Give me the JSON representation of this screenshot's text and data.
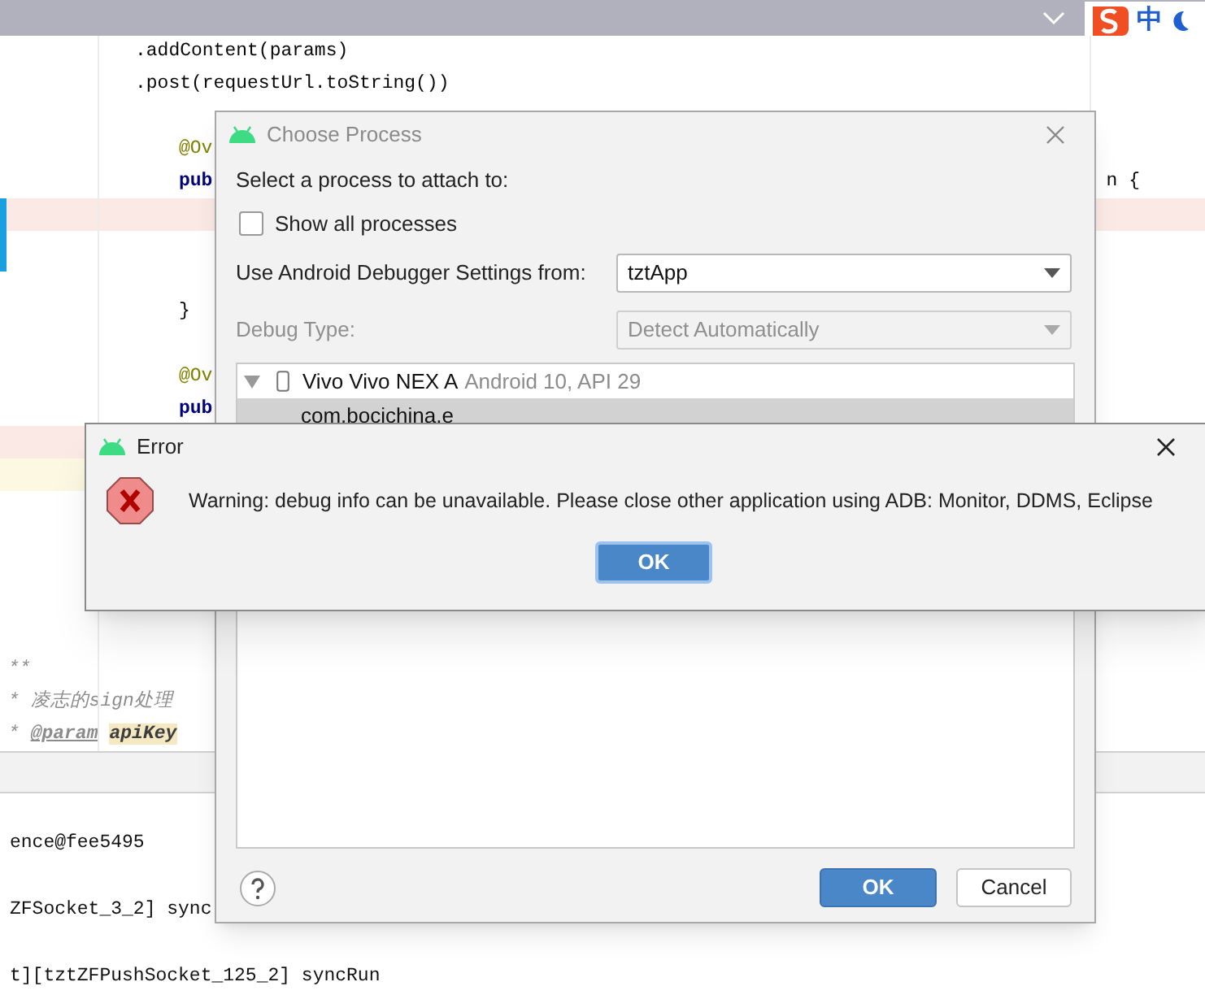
{
  "top_bar": {
    "ime_label": "中"
  },
  "editor": {
    "lines": [
      {
        "kind": "chain",
        "parts": [
          {
            "text": ".addContent(params)",
            "kind": "plain"
          }
        ]
      },
      {
        "kind": "chain",
        "parts": [
          {
            "text": ".post(requestUrl.toString())",
            "kind": "plain"
          }
        ]
      },
      {
        "kind": "chain"
      },
      {
        "kind": "member",
        "parts": [
          {
            "text": "@Ov",
            "kind": "annotation"
          }
        ]
      },
      {
        "kind": "member",
        "parts": [
          {
            "text": "pub",
            "kind": "keyword"
          }
        ],
        "right": "n {"
      },
      {
        "kind": "member",
        "has_error": true
      },
      {
        "kind": "member"
      },
      {
        "kind": "member"
      },
      {
        "kind": "member",
        "parts": [
          {
            "text": "}",
            "kind": "plain"
          }
        ]
      },
      {
        "kind": "member"
      },
      {
        "kind": "member",
        "parts": [
          {
            "text": "@Ov",
            "kind": "annotation"
          }
        ]
      },
      {
        "kind": "member",
        "parts": [
          {
            "text": "pub",
            "kind": "keyword"
          }
        ]
      },
      {
        "kind": "member",
        "has_error": true
      },
      {
        "kind": "member",
        "has_warning": true
      },
      {
        "kind": "member"
      },
      {
        "kind": "member"
      },
      {
        "kind": "member"
      },
      {
        "kind": "member"
      },
      {
        "kind": "member"
      },
      {
        "kind": "doc",
        "parts": [
          {
            "text": "**",
            "kind": "comment"
          }
        ]
      },
      {
        "kind": "doc",
        "parts": [
          {
            "text": "* 凌志的sign处理",
            "kind": "comment"
          }
        ]
      },
      {
        "kind": "doc",
        "parts": [
          {
            "text": "* ",
            "kind": "comment"
          },
          {
            "text": "@param",
            "kind": "doc_tag"
          },
          {
            "text": "apiKey",
            "kind": "param"
          }
        ]
      }
    ]
  },
  "console": {
    "lines": [
      "ence@fee5495",
      "ZFSocket_3_2] sync",
      "t][tztZFPushSocket_125_2] syncRun"
    ]
  },
  "choose_process": {
    "title": "Choose Process",
    "prompt": "Select a process to attach to:",
    "show_all": {
      "label": "Show all processes",
      "checked": false
    },
    "settings": {
      "label": "Use Android Debugger Settings from:",
      "value": "tztApp",
      "disabled": false
    },
    "debug_type": {
      "label": "Debug Type:",
      "value": "Detect Automatically",
      "disabled": true
    },
    "devices": [
      {
        "name": "Vivo Vivo NEX A",
        "detail": "Android 10, API 29",
        "expanded": true,
        "children": [
          {
            "name": "com.bocichina.e",
            "selected": true
          }
        ]
      }
    ],
    "ok": "OK",
    "cancel": "Cancel"
  },
  "error_dialog": {
    "title": "Error",
    "message": "Warning: debug info can be unavailable. Please close other application using ADB: Monitor, DDMS, Eclipse",
    "ok": "OK"
  }
}
